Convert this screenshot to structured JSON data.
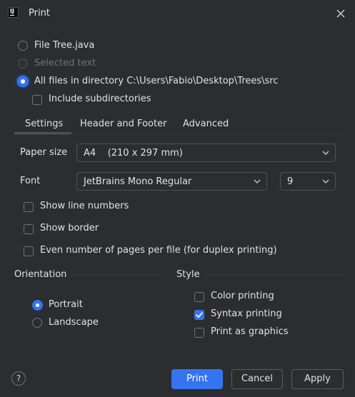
{
  "window": {
    "title": "Print",
    "app_icon_text": "IJ"
  },
  "scope": {
    "options": [
      {
        "label": "File Tree.java",
        "state": "unselected"
      },
      {
        "label": "Selected text",
        "state": "disabled"
      },
      {
        "label": "All files in directory C:\\Users\\Fabio\\Desktop\\Trees\\src",
        "state": "selected"
      }
    ],
    "include_subdirectories": {
      "label": "Include subdirectories",
      "checked": false
    }
  },
  "tabs": [
    {
      "label": "Settings",
      "active": true
    },
    {
      "label": "Header and Footer",
      "active": false
    },
    {
      "label": "Advanced",
      "active": false
    }
  ],
  "settings": {
    "paper_size": {
      "label": "Paper size",
      "value": "A4    (210 x 297 mm)"
    },
    "font": {
      "label": "Font",
      "value": "JetBrains Mono Regular",
      "size": "9"
    },
    "checkboxes": [
      {
        "label": "Show line numbers",
        "checked": false
      },
      {
        "label": "Show border",
        "checked": false
      },
      {
        "label": "Even number of pages per file (for duplex printing)",
        "checked": false
      }
    ],
    "orientation": {
      "title": "Orientation",
      "options": [
        {
          "label": "Portrait",
          "selected": true
        },
        {
          "label": "Landscape",
          "selected": false
        }
      ]
    },
    "style": {
      "title": "Style",
      "options": [
        {
          "label": "Color printing",
          "checked": false
        },
        {
          "label": "Syntax printing",
          "checked": true
        },
        {
          "label": "Print as graphics",
          "checked": false
        }
      ]
    }
  },
  "footer": {
    "help": "?",
    "print": "Print",
    "cancel": "Cancel",
    "apply": "Apply"
  },
  "colors": {
    "accent": "#3574f0",
    "background": "#2b2d30",
    "text": "#dfe1e5"
  }
}
